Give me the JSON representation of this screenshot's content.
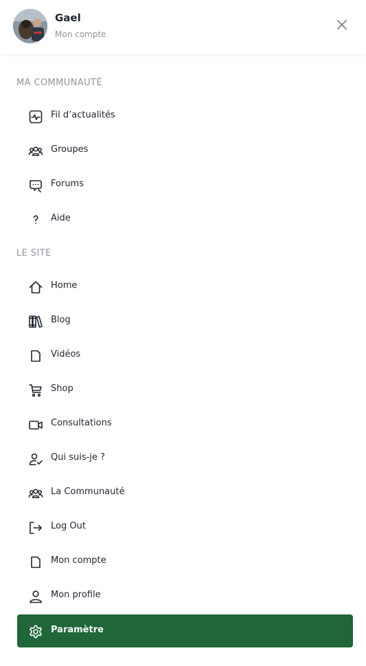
{
  "header": {
    "user_name": "Gael",
    "account_link": "Mon compte",
    "close_icon": "close-icon"
  },
  "sections": [
    {
      "title": "MA COMMUNAUTÉ",
      "items": [
        {
          "label": "Fil d’actualités",
          "icon": "activity-icon"
        },
        {
          "label": "Groupes",
          "icon": "group-icon"
        },
        {
          "label": "Forums",
          "icon": "chat-icon"
        },
        {
          "label": "Aide",
          "icon": "help-icon"
        }
      ]
    },
    {
      "title": "LE SITE",
      "items": [
        {
          "label": "Home",
          "icon": "home-icon"
        },
        {
          "label": "Blog",
          "icon": "books-icon"
        },
        {
          "label": "Vidéos",
          "icon": "file-icon"
        },
        {
          "label": "Shop",
          "icon": "cart-icon"
        },
        {
          "label": "Consultations",
          "icon": "video-camera-icon"
        },
        {
          "label": "Qui suis-je ?",
          "icon": "user-check-icon"
        },
        {
          "label": "La Communauté",
          "icon": "group-icon"
        },
        {
          "label": "Log Out",
          "icon": "logout-icon"
        },
        {
          "label": "Mon compte",
          "icon": "file-icon"
        },
        {
          "label": "Mon profile",
          "icon": "user-icon"
        },
        {
          "label": "Paramètre",
          "icon": "gear-icon",
          "active": true
        }
      ]
    }
  ],
  "colors": {
    "active_bg": "#1f6638",
    "text": "#1f2430",
    "muted": "#8f949c"
  }
}
